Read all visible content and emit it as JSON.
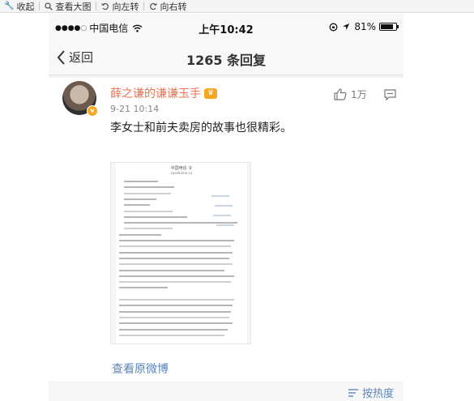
{
  "viewer_toolbar": {
    "items": [
      {
        "icon": "wrench-icon",
        "label": "收起"
      },
      {
        "icon": "search-icon",
        "label": "查看大图"
      },
      {
        "icon": "rotate-left-icon",
        "label": "向左转"
      },
      {
        "icon": "rotate-right-icon",
        "label": "向右转"
      }
    ]
  },
  "status_bar": {
    "carrier": "中国电信",
    "time": "上午10:42",
    "battery": "81%",
    "battery_level": 0.81
  },
  "nav": {
    "back_label": "返回",
    "title": "1265 条回复"
  },
  "comment": {
    "username": "薛之谦的谦谦玉手",
    "time": "9-21 10:14",
    "like_count": "1万",
    "text": "李女士和前夫卖房的故事也很精彩。",
    "view_original": "查看原微博"
  },
  "document_image": {
    "header_line1": "中国电信 令",
    "header_line2": "casehome.cn"
  },
  "sort": {
    "label": "按热度"
  },
  "colors": {
    "username": "#eb7350",
    "link": "#5d85b8",
    "vip_badge": "#f5a623"
  }
}
